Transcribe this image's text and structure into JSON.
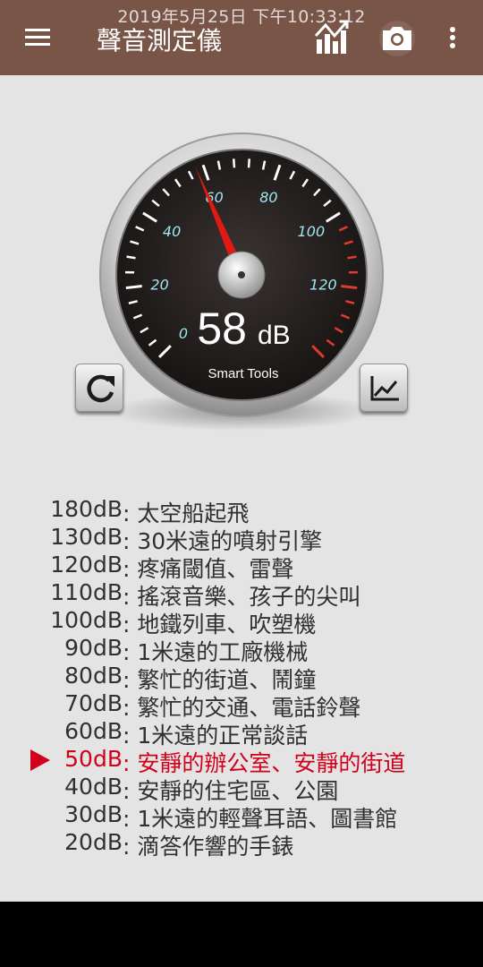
{
  "status_bar": {
    "timestamp": "2019年5月25日 下午10:33:12"
  },
  "toolbar": {
    "title": "聲音測定儀",
    "icons": [
      "menu-icon",
      "chart-icon",
      "camera-icon",
      "more-vert-icon"
    ]
  },
  "gauge": {
    "reading_value": "58",
    "reading_unit": "dB",
    "brand": "Smart Tools",
    "needle_value": 58,
    "scale_labels": [
      "0",
      "20",
      "40",
      "60",
      "80",
      "100",
      "120"
    ],
    "colors": {
      "dial": "#1e1b1a",
      "ticks": "#ffffff",
      "labels": "#9fe6f2",
      "red_zone": "#e23b2e",
      "needle": "#e01a12"
    }
  },
  "buttons": {
    "reset_icon": "refresh-icon",
    "graph_icon": "line-chart-icon"
  },
  "reference": {
    "active_index": 9,
    "rows": [
      {
        "level": "180dB",
        "desc": "太空船起飛"
      },
      {
        "level": "130dB",
        "desc": "30米遠的噴射引擎"
      },
      {
        "level": "120dB",
        "desc": "疼痛閾值、雷聲"
      },
      {
        "level": "110dB",
        "desc": "搖滾音樂、孩子的尖叫"
      },
      {
        "level": "100dB",
        "desc": "地鐵列車、吹塑機"
      },
      {
        "level": "90dB",
        "desc": "1米遠的工廠機械"
      },
      {
        "level": "80dB",
        "desc": "繁忙的街道、鬧鐘"
      },
      {
        "level": "70dB",
        "desc": "繁忙的交通、電話鈴聲"
      },
      {
        "level": "60dB",
        "desc": "1米遠的正常談話"
      },
      {
        "level": "50dB",
        "desc": "安靜的辦公室、安靜的街道"
      },
      {
        "level": "40dB",
        "desc": "安靜的住宅區、公園"
      },
      {
        "level": "30dB",
        "desc": "1米遠的輕聲耳語、圖書館"
      },
      {
        "level": "20dB",
        "desc": "滴答作響的手錶"
      }
    ]
  },
  "colors": {
    "toolbar": "#795548",
    "background": "#e4e4e4",
    "active_text": "#d0021b"
  }
}
